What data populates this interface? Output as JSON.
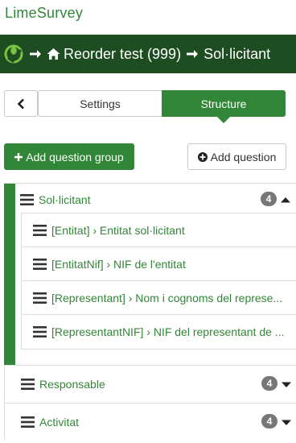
{
  "brand": "LimeSurvey",
  "breadcrumb": {
    "survey": "Reorder test (999)",
    "group": "Sol·licitant"
  },
  "tabs": {
    "settings": "Settings",
    "structure": "Structure"
  },
  "buttons": {
    "add_group": "Add question group",
    "add_question": "Add question"
  },
  "groups": [
    {
      "title": "Sol·licitant",
      "count": "4",
      "expanded": true,
      "questions": [
        "[Entitat] › Entitat sol·licitant",
        "[EntitatNif] › NIF de l'entitat",
        "[Representant] › Nom i cognoms del represe...",
        "[RepresentantNIF] › NIF del representant de ..."
      ]
    },
    {
      "title": "Responsable",
      "count": "4",
      "expanded": false
    },
    {
      "title": "Activitat",
      "count": "4",
      "expanded": false
    }
  ],
  "colors": {
    "brand_green": "#328637",
    "dark_green": "#1e4d22",
    "badge_grey": "#777777"
  },
  "icons": {
    "logo": "limesurvey-logo-icon",
    "arrow": "arrow-right-icon",
    "home": "home-icon",
    "back": "chevron-left-icon",
    "plus": "plus-icon",
    "plus_circle": "plus-circle-icon",
    "drag": "hamburger-drag-icon",
    "caret_up": "caret-up-icon",
    "caret_down": "caret-down-icon"
  }
}
